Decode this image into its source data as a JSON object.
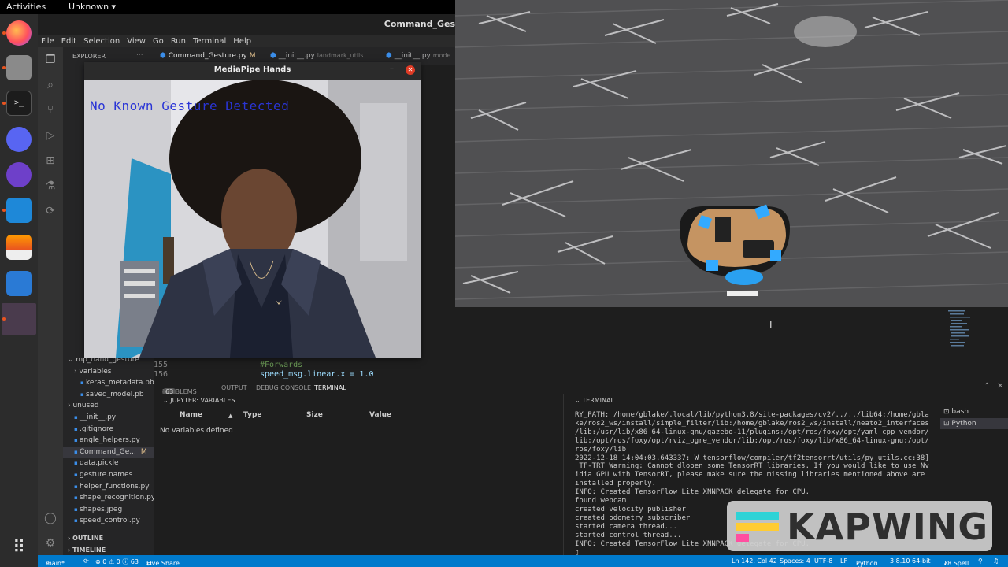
{
  "topbar": {
    "activities": "Activities",
    "app_menu": "Unknown ▾"
  },
  "vscode": {
    "title": "Command_Ges",
    "menu": [
      "File",
      "Edit",
      "Selection",
      "View",
      "Go",
      "Run",
      "Terminal",
      "Help"
    ],
    "explorer_header": "EXPLORER",
    "explorer_dots": "···",
    "tabs": [
      {
        "label": "Command_Gesture.py",
        "mod": "M"
      },
      {
        "label": "__init__.py",
        "path": "landmark_utils"
      },
      {
        "label": "__init__.py",
        "path": "mode"
      }
    ],
    "file_tree": [
      {
        "label": "mp_hand_gesture",
        "arrow": "⌄",
        "indent": 0
      },
      {
        "label": "variables",
        "arrow": "›",
        "indent": 1
      },
      {
        "label": "keras_metadata.pb",
        "arrow": "",
        "indent": 2
      },
      {
        "label": "saved_model.pb",
        "arrow": "",
        "indent": 2
      },
      {
        "label": "unused",
        "arrow": "›",
        "indent": 0
      },
      {
        "label": "__init__.py",
        "arrow": "",
        "indent": 1
      },
      {
        "label": ".gitignore",
        "arrow": "",
        "indent": 1
      },
      {
        "label": "angle_helpers.py",
        "arrow": "",
        "indent": 1
      },
      {
        "label": "Command_Ge...",
        "arrow": "",
        "indent": 1,
        "mod": "M",
        "selected": true
      },
      {
        "label": "data.pickle",
        "arrow": "",
        "indent": 1
      },
      {
        "label": "gesture.names",
        "arrow": "",
        "indent": 1
      },
      {
        "label": "helper_functions.py",
        "arrow": "",
        "indent": 1
      },
      {
        "label": "shape_recognition.py",
        "arrow": "",
        "indent": 1
      },
      {
        "label": "shapes.jpeg",
        "arrow": "",
        "indent": 1
      },
      {
        "label": "speed_control.py",
        "arrow": "",
        "indent": 1
      }
    ],
    "outline": "OUTLINE",
    "timeline": "TIMELINE",
    "code": [
      {
        "line": "155",
        "text": "#Forwards",
        "color": "#6a9955"
      },
      {
        "line": "156",
        "text": "speed_msg.linear.x = 1.0",
        "color": "#9cdcfe"
      }
    ],
    "panel_tabs": [
      {
        "label": "PROBLEMS",
        "badge": "63"
      },
      {
        "label": "OUTPUT"
      },
      {
        "label": "DEBUG CONSOLE"
      },
      {
        "label": "TERMINAL",
        "active": true
      }
    ],
    "variables": {
      "title": "JUPYTER: VARIABLES",
      "columns": [
        "Name",
        "Type",
        "Size",
        "Value"
      ],
      "sort_arrow": "▲",
      "empty": "No variables defined"
    },
    "terminal": {
      "title": "TERMINAL",
      "lines": [
        "RY_PATH: /home/gblake/.local/lib/python3.8/site-packages/cv2/../../lib64:/home/gbla",
        "ke/ros2_ws/install/simple_filter/lib:/home/gblake/ros2_ws/install/neato2_interfaces",
        "/lib:/usr/lib/x86_64-linux-gnu/gazebo-11/plugins:/opt/ros/foxy/opt/yaml_cpp_vendor/",
        "lib:/opt/ros/foxy/opt/rviz_ogre_vendor/lib:/opt/ros/foxy/lib/x86_64-linux-gnu:/opt/",
        "ros/foxy/lib",
        "2022-12-18 14:04:03.643337: W tensorflow/compiler/tf2tensorrt/utils/py_utils.cc:38]",
        " TF-TRT Warning: Cannot dlopen some TensorRT libraries. If you would like to use Nv",
        "idia GPU with TensorRT, please make sure the missing libraries mentioned above are",
        "installed properly.",
        "INFO: Created TensorFlow Lite XNNPACK delegate for CPU.",
        "found webcam",
        "created velocity publisher",
        "created odometry subscriber",
        "started camera thread...",
        "started control thread...",
        "INFO: Created TensorFlow Lite XNNPACK delegate for CPU.",
        "▯"
      ],
      "shells": [
        "bash",
        "Python"
      ]
    },
    "status": {
      "branch": "main*",
      "sync": "⟳",
      "problems": "⊗ 0 ⚠ 0 ⓘ 63",
      "live_share": "Live Share",
      "position": "Ln 142, Col 42",
      "spaces": "Spaces: 4",
      "encoding": "UTF-8",
      "eol": "LF",
      "language": "Python",
      "interpreter": "3.8.10 64-bit",
      "spell": "18 Spell"
    }
  },
  "camera_window": {
    "title": "MediaPipe Hands",
    "minimize": "–",
    "close": "✕",
    "overlay_text": "No Known Gesture Detected",
    "overlay_color": "#2a35d6"
  },
  "watermark": {
    "text": "KAPWING"
  },
  "colors": {
    "vscode_blue": "#007acc",
    "close_red": "#e03b25",
    "dock_accent": "#e95420"
  }
}
